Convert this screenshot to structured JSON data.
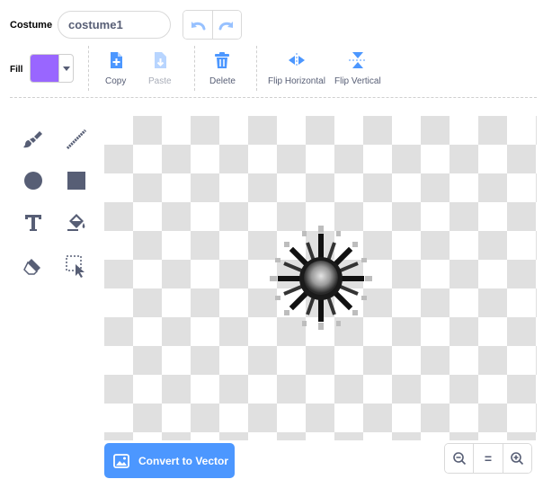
{
  "costume": {
    "label": "Costume",
    "name_value": "costume1"
  },
  "fill": {
    "label": "Fill",
    "color": "#9966ff"
  },
  "actions": {
    "copy": "Copy",
    "paste": "Paste",
    "delete": "Delete",
    "flip_horizontal": "Flip Horizontal",
    "flip_vertical": "Flip Vertical"
  },
  "tools": [
    "brush-icon",
    "line-icon",
    "circle-icon",
    "rectangle-icon",
    "text-icon",
    "fill-icon",
    "eraser-icon",
    "select-icon"
  ],
  "bottom": {
    "convert_label": "Convert to Vector",
    "reset_zoom_label": "="
  },
  "colors": {
    "accent": "#4c97ff",
    "text": "#575e75",
    "fill": "#9966ff"
  }
}
